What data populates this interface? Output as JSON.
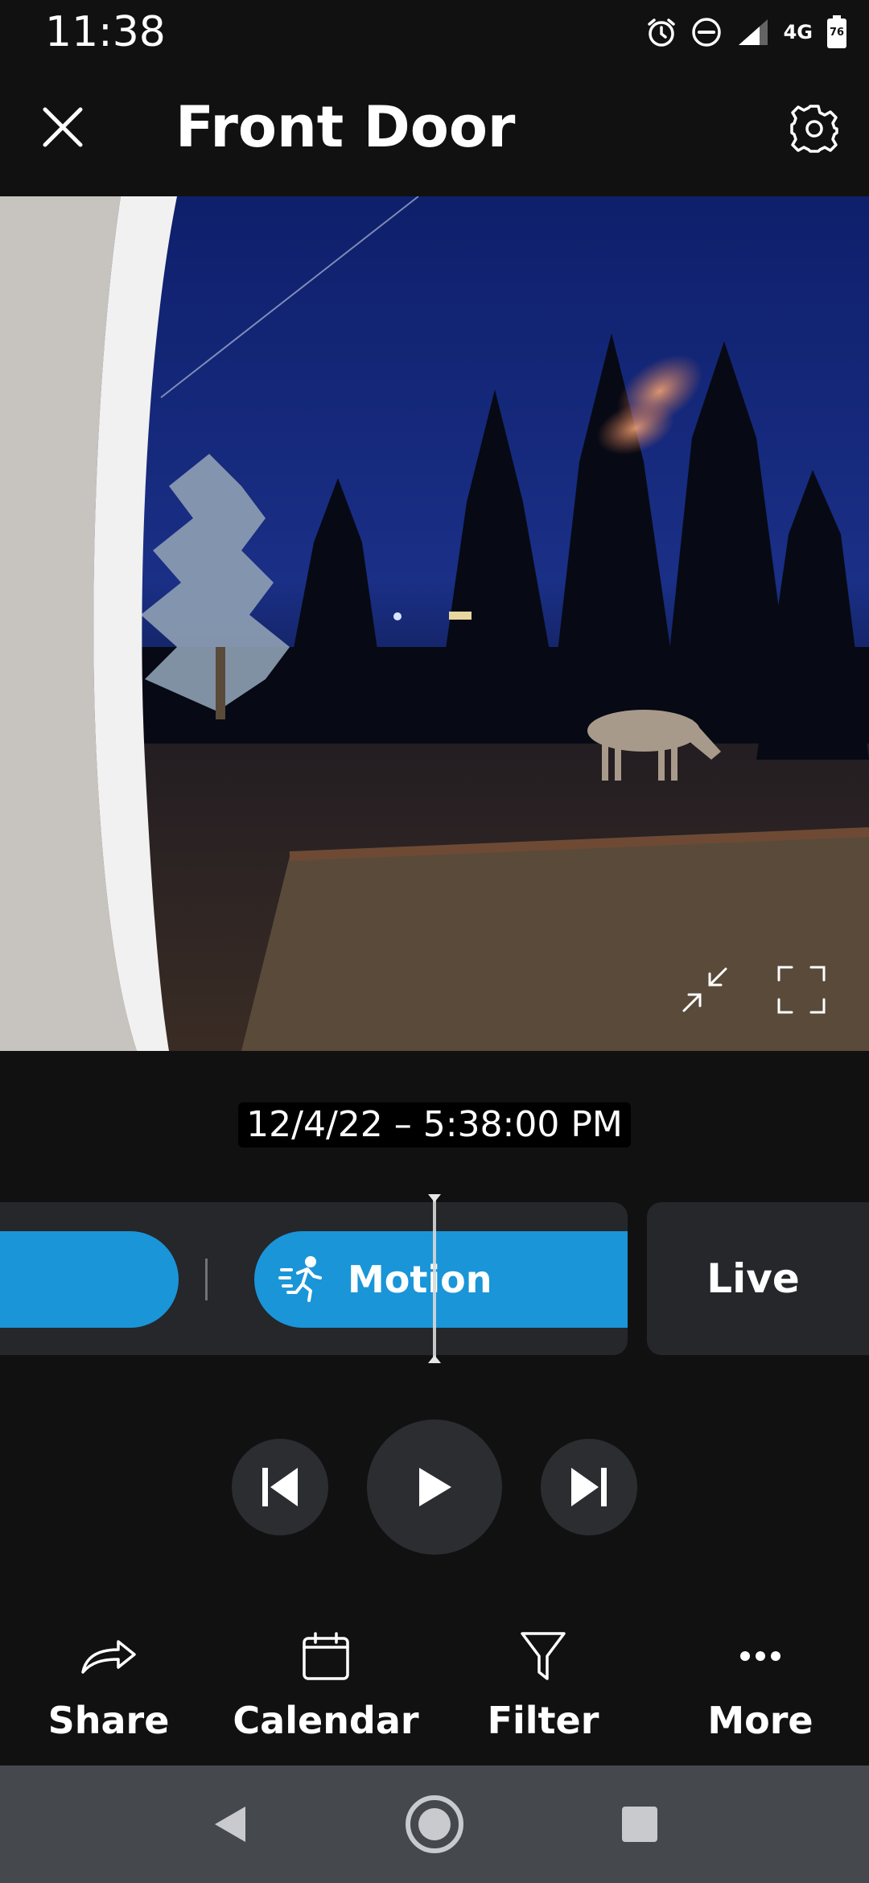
{
  "status_bar": {
    "time": "11:38",
    "network": "4G",
    "battery": "76",
    "icons": [
      "alarm-icon",
      "do-not-disturb-icon",
      "signal-icon",
      "battery-icon"
    ]
  },
  "header": {
    "title": "Front Door",
    "close_icon": "close-icon",
    "settings_icon": "gear-icon"
  },
  "video": {
    "timestamp": "12/4/22 – 5:38:00 PM",
    "collapse_icon": "collapse-icon",
    "fullscreen_icon": "fullscreen-icon"
  },
  "timeline": {
    "events": [
      {
        "type": "motion",
        "label": ""
      },
      {
        "type": "motion",
        "label": "Motion",
        "icon": "running-person-icon"
      }
    ],
    "live_label": "Live"
  },
  "playback": {
    "prev_icon": "skip-previous-icon",
    "play_icon": "play-icon",
    "next_icon": "skip-next-icon"
  },
  "actions": [
    {
      "label": "Share",
      "icon": "share-icon"
    },
    {
      "label": "Calendar",
      "icon": "calendar-icon"
    },
    {
      "label": "Filter",
      "icon": "filter-icon"
    },
    {
      "label": "More",
      "icon": "more-icon"
    }
  ],
  "nav": {
    "back_icon": "back-triangle-icon",
    "home_icon": "home-circle-icon",
    "recents_icon": "recents-square-icon"
  },
  "colors": {
    "background": "#111111",
    "accent": "#1a95d8",
    "tile": "#25272b",
    "nav_bar": "#45484d"
  }
}
